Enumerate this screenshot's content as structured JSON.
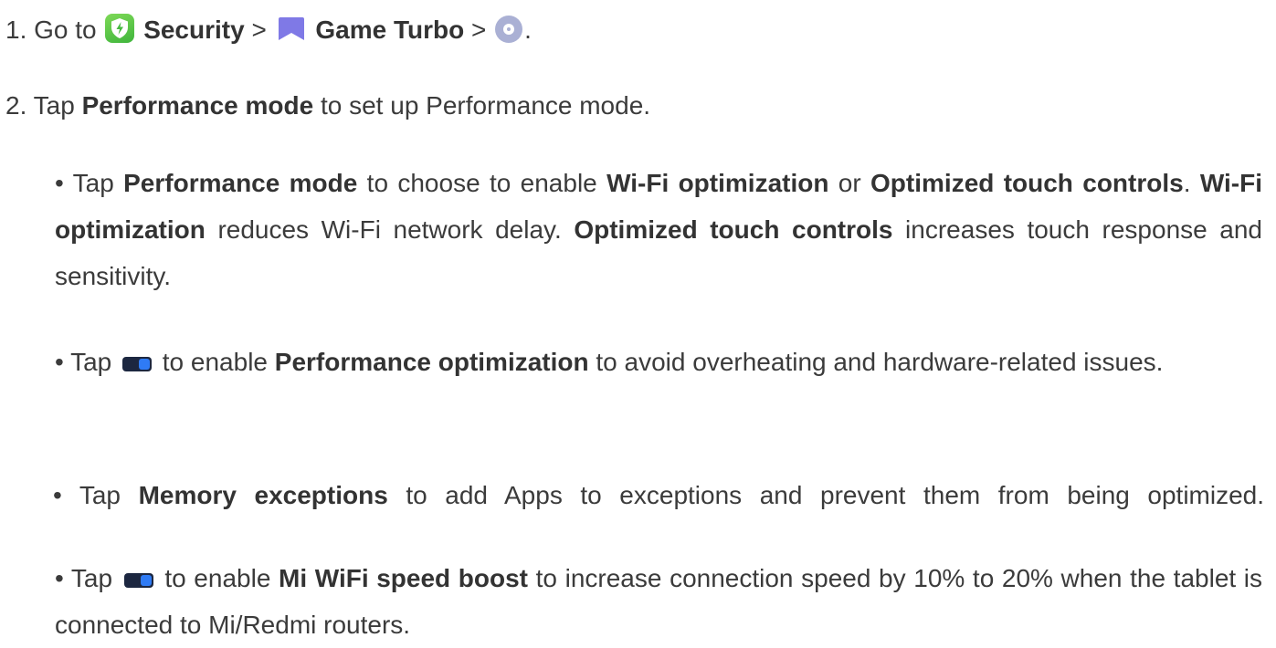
{
  "step1": {
    "prefix": "1. Go to ",
    "security_label": "Security",
    "sep1": " > ",
    "game_turbo_label": "Game Turbo",
    "sep2": " > ",
    "suffix": ".",
    "icons": [
      "security-app-icon",
      "game-turbo-app-icon",
      "settings-gear-icon"
    ]
  },
  "step2": {
    "prefix": "2. Tap ",
    "bold": "Performance mode",
    "suffix": " to set up Performance mode."
  },
  "bullets": [
    {
      "segments": [
        {
          "text": "• Tap ",
          "bold": false
        },
        {
          "text": "Performance mode",
          "bold": true
        },
        {
          "text": " to choose to enable ",
          "bold": false
        },
        {
          "text": "Wi-Fi optimization",
          "bold": true
        },
        {
          "text": " or ",
          "bold": false
        },
        {
          "text": "Optimized touch controls",
          "bold": true
        },
        {
          "text": ". ",
          "bold": false
        },
        {
          "text": "Wi-Fi optimization",
          "bold": true
        },
        {
          "text": " reduces Wi-Fi network delay. ",
          "bold": false
        },
        {
          "text": "Optimized touch controls",
          "bold": true
        },
        {
          "text": " increases touch response and sensitivity.",
          "bold": false
        }
      ]
    },
    {
      "segments": [
        {
          "text": "• Tap ",
          "bold": false
        },
        {
          "icon": "toggle-switch-icon"
        },
        {
          "text": " to enable ",
          "bold": false
        },
        {
          "text": "Performance optimization",
          "bold": true
        },
        {
          "text": " to avoid overheating and hardware-related issues.",
          "bold": false
        }
      ]
    },
    {
      "segments": [
        {
          "text": "• Tap ",
          "bold": false
        },
        {
          "text": "Memory exceptions",
          "bold": true
        },
        {
          "text": " to add Apps to exceptions and prevent them from being optimized.",
          "bold": false
        }
      ]
    },
    {
      "segments": [
        {
          "text": "• Tap ",
          "bold": false
        },
        {
          "icon": "toggle-switch-icon"
        },
        {
          "text": " to enable ",
          "bold": false
        },
        {
          "text": "Mi WiFi speed boost",
          "bold": true
        },
        {
          "text": " to increase connection speed by 10% to 20% when the tablet is connected to Mi/Redmi routers.",
          "bold": false
        }
      ]
    }
  ],
  "colors": {
    "text": "#3b3b3b",
    "security_icon": "#4cbf3f",
    "game_turbo_icon": "#7f79e6",
    "gear_icon": "#aab0d4",
    "toggle_icon": "#1c2740"
  }
}
